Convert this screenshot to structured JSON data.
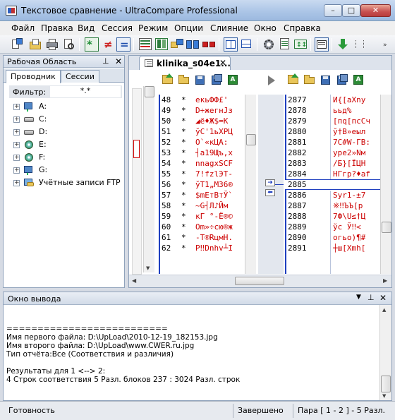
{
  "window": {
    "title": "Текстовое сравнение - UltraCompare Professional",
    "controls": {
      "minimize": "–",
      "maximize": "□",
      "close": "✕"
    }
  },
  "menu": [
    "Файл",
    "Правка",
    "Вид",
    "Сессия",
    "Режим",
    "Опции",
    "Слияние",
    "Окно",
    "Справка"
  ],
  "workspace": {
    "title": "Рабочая Область",
    "pin": "⊥",
    "close": "✕",
    "tabs": [
      "Проводник",
      "Сессии"
    ],
    "filter_label": "Фильтр:",
    "filter_value": "*.*",
    "tree": [
      {
        "label": "A:",
        "icon": "network-drive-icon"
      },
      {
        "label": "C:",
        "icon": "hard-drive-icon"
      },
      {
        "label": "D:",
        "icon": "hard-drive-icon"
      },
      {
        "label": "E:",
        "icon": "cd-drive-icon"
      },
      {
        "label": "F:",
        "icon": "cd-drive-icon"
      },
      {
        "label": "G:",
        "icon": "network-drive-icon"
      },
      {
        "label": "Учётные записи FTP",
        "icon": "ftp-accounts-icon"
      }
    ]
  },
  "document": {
    "tab_label": "klinika_s04e1...",
    "tab_close": "✕",
    "left_pane": {
      "lines": [
        {
          "n": "48",
          "s": "*",
          "c": "екьФФ£'"
        },
        {
          "n": "49",
          "s": "*",
          "c": "D÷жегнJз"
        },
        {
          "n": "50",
          "s": "*",
          "c": "◢ё♦Ж$=К"
        },
        {
          "n": "51",
          "s": "*",
          "c": "ўС'1ьХРЦ"
        },
        {
          "n": "52",
          "s": "*",
          "c": "  О`«кЦА:"
        },
        {
          "n": "53",
          "s": "*",
          "c": "┤а19Щъ,х"
        },
        {
          "n": "54",
          "s": "*",
          "c": "nnagxSCF"
        },
        {
          "n": "55",
          "s": "*",
          "c": "7!fzlЭТ-"
        },
        {
          "n": "56",
          "s": "*",
          "c": "ўТ1„М36®"
        },
        {
          "n": "57",
          "s": "*",
          "c": "$mЕтВтЎ`"
        },
        {
          "n": "58",
          "s": "*",
          "c": "~G┤Л♪Йм"
        },
        {
          "n": "59",
          "s": "*",
          "c": "кГ °-Ё®©"
        },
        {
          "n": "60",
          "s": "*",
          "c": "Om»÷сю®ж"
        },
        {
          "n": "61",
          "s": "*",
          "c": "-Т®RцмН."
        },
        {
          "n": "62",
          "s": "*",
          "c": "P‼Dnhv┴I"
        }
      ]
    },
    "right_pane": {
      "lines": [
        {
          "n": "2877",
          "c": "И{[aXnу"
        },
        {
          "n": "2878",
          "c": "ььд%"
        },
        {
          "n": "2879",
          "c": "[пq[псСч"
        },
        {
          "n": "2880",
          "c": "ў†В»еыл"
        },
        {
          "n": "2881",
          "c": "7С#W-ГВ:"
        },
        {
          "n": "2882",
          "c": "уре2»Nм"
        },
        {
          "n": "2883",
          "c": "/Б}[ЇЦН"
        },
        {
          "n": "2884",
          "c": "НГгр?♦аf"
        },
        {
          "n": "2885",
          "c": ""
        },
        {
          "n": "2886",
          "c": "Syr1-±7"
        },
        {
          "n": "2887",
          "c": "※‼ЪЪ[р"
        },
        {
          "n": "2888",
          "c": "7Ф\\U≤†Ц"
        },
        {
          "n": "2889",
          "c": "ўс  Ў‼<"
        },
        {
          "n": "2890",
          "c": "огьо)¶#"
        },
        {
          "n": "2891",
          "c": "┼ш[Xmh["
        }
      ]
    }
  },
  "output": {
    "title": "Окно вывода",
    "pin": "▼",
    "pin2": "⊥",
    "close": "✕",
    "lines": [
      "==========================",
      "Имя первого файла: D:\\UpLoad\\2010-12-19_182153.jpg",
      "Имя второго файла: D:\\UpLoad\\www.CWER.ru.jpg",
      "Тип отчёта:Все (Соответствия и различия)",
      "",
      "Результаты для 1 <--> 2:",
      "4 Строк соответствия   5 Разл. блоков   237 : 3024 Разл. строк"
    ]
  },
  "status": {
    "ready": "Готовность",
    "done": "Завершено",
    "pair": "Пара [ 1 - 2 ] - 5 Разл."
  },
  "colors": {
    "diff_red": "#cc0000",
    "diff_border": "#1f3fbf",
    "titlebar": "#aac4e6"
  }
}
